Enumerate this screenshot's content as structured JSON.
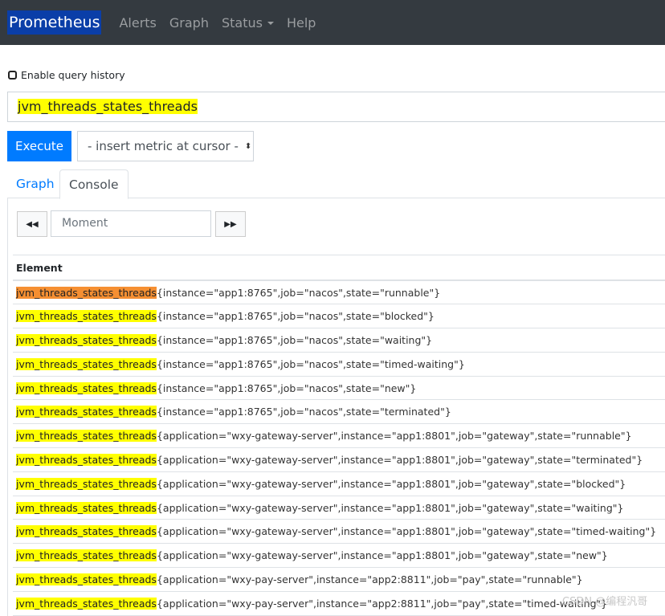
{
  "nav": {
    "brand": "Prometheus",
    "items": [
      "Alerts",
      "Graph",
      "Status",
      "Help"
    ]
  },
  "history_label": "Enable query history",
  "query": "jvm_threads_states_threads",
  "execute": "Execute",
  "insert_metric": "- insert metric at cursor -",
  "tabs": [
    "Graph",
    "Console"
  ],
  "active_tab": "Console",
  "moment_placeholder": "Moment",
  "table": {
    "header": "Element",
    "rows": [
      {
        "metric": "jvm_threads_states_threads",
        "labels": "{instance=\"app1:8765\",job=\"nacos\",state=\"runnable\"}"
      },
      {
        "metric": "jvm_threads_states_threads",
        "labels": "{instance=\"app1:8765\",job=\"nacos\",state=\"blocked\"}"
      },
      {
        "metric": "jvm_threads_states_threads",
        "labels": "{instance=\"app1:8765\",job=\"nacos\",state=\"waiting\"}"
      },
      {
        "metric": "jvm_threads_states_threads",
        "labels": "{instance=\"app1:8765\",job=\"nacos\",state=\"timed-waiting\"}"
      },
      {
        "metric": "jvm_threads_states_threads",
        "labels": "{instance=\"app1:8765\",job=\"nacos\",state=\"new\"}"
      },
      {
        "metric": "jvm_threads_states_threads",
        "labels": "{instance=\"app1:8765\",job=\"nacos\",state=\"terminated\"}"
      },
      {
        "metric": "jvm_threads_states_threads",
        "labels": "{application=\"wxy-gateway-server\",instance=\"app1:8801\",job=\"gateway\",state=\"runnable\"}"
      },
      {
        "metric": "jvm_threads_states_threads",
        "labels": "{application=\"wxy-gateway-server\",instance=\"app1:8801\",job=\"gateway\",state=\"terminated\"}"
      },
      {
        "metric": "jvm_threads_states_threads",
        "labels": "{application=\"wxy-gateway-server\",instance=\"app1:8801\",job=\"gateway\",state=\"blocked\"}"
      },
      {
        "metric": "jvm_threads_states_threads",
        "labels": "{application=\"wxy-gateway-server\",instance=\"app1:8801\",job=\"gateway\",state=\"waiting\"}"
      },
      {
        "metric": "jvm_threads_states_threads",
        "labels": "{application=\"wxy-gateway-server\",instance=\"app1:8801\",job=\"gateway\",state=\"timed-waiting\"}"
      },
      {
        "metric": "jvm_threads_states_threads",
        "labels": "{application=\"wxy-gateway-server\",instance=\"app1:8801\",job=\"gateway\",state=\"new\"}"
      },
      {
        "metric": "jvm_threads_states_threads",
        "labels": "{application=\"wxy-pay-server\",instance=\"app2:8811\",job=\"pay\",state=\"runnable\"}"
      },
      {
        "metric": "jvm_threads_states_threads",
        "labels": "{application=\"wxy-pay-server\",instance=\"app2:8811\",job=\"pay\",state=\"timed-waiting\"}"
      }
    ]
  },
  "watermark": "CSDN @编程汎哥",
  "colors": {
    "navbar": "#343a40",
    "brand_bg": "#0a3ea8",
    "primary": "#007bff",
    "highlight": "#ffff00",
    "highlight_active": "#f58f32"
  }
}
